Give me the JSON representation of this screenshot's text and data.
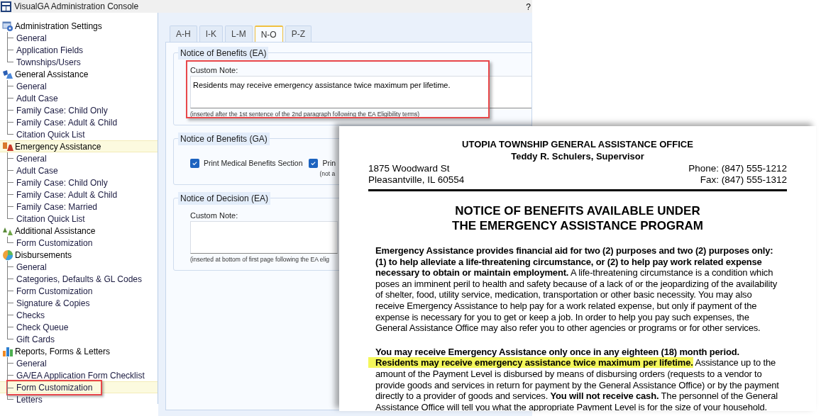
{
  "window": {
    "title": "VisualGA Administration Console",
    "help": "?"
  },
  "sidebar": {
    "groups": [
      {
        "label": "Administration Settings",
        "kind": "settings",
        "selected": false,
        "children": [
          {
            "label": "General",
            "selected": false,
            "outlined": false
          },
          {
            "label": "Application Fields",
            "selected": false,
            "outlined": false
          },
          {
            "label": "Townships/Users",
            "selected": false,
            "outlined": false
          }
        ]
      },
      {
        "label": "General Assistance",
        "kind": "ga",
        "selected": false,
        "children": [
          {
            "label": "General",
            "selected": false,
            "outlined": false
          },
          {
            "label": "Adult Case",
            "selected": false,
            "outlined": false
          },
          {
            "label": "Family Case: Child Only",
            "selected": false,
            "outlined": false
          },
          {
            "label": "Family Case: Adult & Child",
            "selected": false,
            "outlined": false
          },
          {
            "label": "Citation Quick List",
            "selected": false,
            "outlined": false
          }
        ]
      },
      {
        "label": "Emergency Assistance",
        "kind": "ea",
        "selected": true,
        "children": [
          {
            "label": "General",
            "selected": false,
            "outlined": false
          },
          {
            "label": "Adult Case",
            "selected": false,
            "outlined": false
          },
          {
            "label": "Family Case: Child Only",
            "selected": false,
            "outlined": false
          },
          {
            "label": "Family Case: Adult & Child",
            "selected": false,
            "outlined": false
          },
          {
            "label": "Family Case: Married",
            "selected": false,
            "outlined": false
          },
          {
            "label": "Citation Quick List",
            "selected": false,
            "outlined": false
          }
        ]
      },
      {
        "label": "Additional Assistance",
        "kind": "aa",
        "selected": false,
        "children": [
          {
            "label": "Form Customization",
            "selected": false,
            "outlined": false
          }
        ]
      },
      {
        "label": "Disbursements",
        "kind": "pie",
        "selected": false,
        "children": [
          {
            "label": "General",
            "selected": false,
            "outlined": false
          },
          {
            "label": "Categories, Defaults & GL Codes",
            "selected": false,
            "outlined": false
          },
          {
            "label": "Form Customization",
            "selected": false,
            "outlined": false
          },
          {
            "label": "Signature & Copies",
            "selected": false,
            "outlined": false
          },
          {
            "label": "Checks",
            "selected": false,
            "outlined": false
          },
          {
            "label": "Check Queue",
            "selected": false,
            "outlined": false
          },
          {
            "label": "Gift Cards",
            "selected": false,
            "outlined": false
          }
        ]
      },
      {
        "label": "Reports, Forms & Letters",
        "kind": "bars",
        "selected": false,
        "children": [
          {
            "label": "General",
            "selected": false,
            "outlined": false
          },
          {
            "label": "GA/EA Application Form Checklist",
            "selected": false,
            "outlined": false
          },
          {
            "label": "Form Customization",
            "selected": true,
            "outlined": true
          },
          {
            "label": "Letters",
            "selected": false,
            "outlined": false
          }
        ]
      }
    ]
  },
  "tabs": [
    {
      "label": "A-H",
      "selected": false
    },
    {
      "label": "I-K",
      "selected": false
    },
    {
      "label": "L-M",
      "selected": false
    },
    {
      "label": "N-O",
      "selected": true
    },
    {
      "label": "P-Z",
      "selected": false
    }
  ],
  "sections": [
    {
      "kind": "note",
      "legend": "Notice of Benefits (EA)",
      "outlined": true,
      "label": "Custom Note:",
      "value": "Residents may receive emergency assistance twice maximum per lifetime.",
      "hint": "(inserted after the 1st sentence of the 2nd paragraph following the EA Eligibility terms)"
    },
    {
      "kind": "checks",
      "legend": "Notice of Benefits (GA)",
      "outlined": false,
      "checkboxes": [
        {
          "label": "Print Medical Benefits Section",
          "checked": true
        },
        {
          "label": "Prin",
          "checked": true,
          "hint": "(not a"
        }
      ]
    },
    {
      "kind": "note",
      "legend": "Notice of Decision (EA)",
      "outlined": false,
      "label": "Custom Note:",
      "hint": "(inserted at bottom of first page following the EA elig"
    }
  ],
  "document": {
    "office": "UTOPIA TOWNSHIP GENERAL ASSISTANCE OFFICE",
    "supervisor": "Teddy R. Schulers, Supervisor",
    "address": [
      "1875 Woodward St",
      "Pleasantville, IL 60554"
    ],
    "contact": [
      "Phone: (847) 555-1212",
      "Fax: (847) 555-1312"
    ],
    "title": [
      "NOTICE OF BENEFITS AVAILABLE UNDER",
      "THE EMERGENCY ASSISTANCE PROGRAM"
    ],
    "paragraphs": [
      {
        "text": "**Emergency Assistance provides financial aid for two (2) purposes and two (2) purposes only: (1) to help alleviate a life-threatening circumstance, or (2) to help pay work related expense necessary to obtain or maintain employment.** A life-threatening circumstance is a condition which poses an imminent peril to health and safety because of a lack of or the jeopardizing of the availability of shelter, food, utility service, medication, transportation or other basic necessity. You may also receive Emergency Assistance to help pay for a work related expense, but only if payment of the expense is necessary for you to get or keep a job. In order to help you pay such expenses, the General Assistance Office may also refer you to other agencies or programs or for other services."
      },
      {
        "lead": "You may receive Emergency Assistance only once in any eighteen (18) month period.",
        "highlighted": "Residents may receive emergency assistance twice maximum per lifetime.",
        "text": "Assistance up to the amount of the Payment Level is disbursed by means of disbursing orders (requests to a vendor to provide goods and services in return for payment by the General Assistance Office) or by the payment directly to a provider of goods and services. **You will not receive cash.** The personnel of the General Assistance Office will tell you what the appropriate Payment Level is for the size of your household."
      }
    ]
  }
}
